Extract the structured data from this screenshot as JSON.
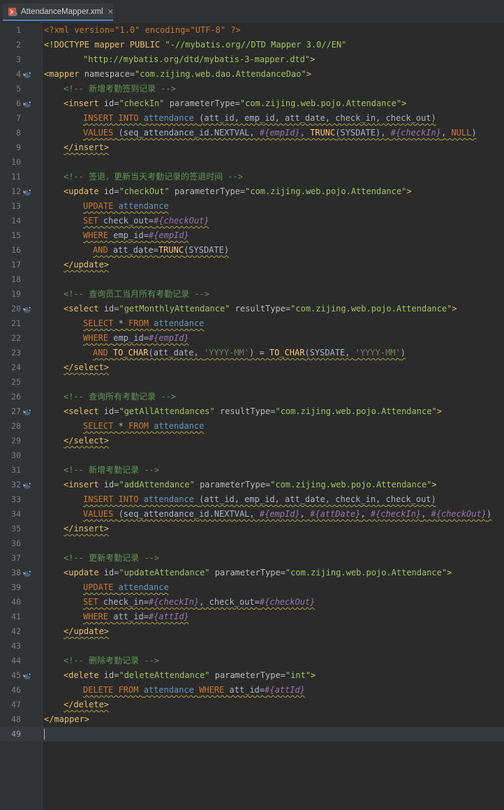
{
  "tab": {
    "title": "AttendanceMapper.xml",
    "close": "×",
    "icon": "xml-file-icon"
  },
  "current_line": 49,
  "lines": [
    {
      "n": "1",
      "bean": false,
      "parts": [
        [
          "xm",
          "<?xml version=\"1.0\" encoding=\"UTF-8\" ?>"
        ]
      ]
    },
    {
      "n": "2",
      "bean": false,
      "parts": [
        [
          "dt",
          "<!DOCTYPE mapper PUBLIC "
        ],
        [
          "av",
          "\"-//mybatis.org//DTD Mapper 3.0//EN\""
        ]
      ]
    },
    {
      "n": "3",
      "bean": false,
      "indent": "ind4",
      "parts": [
        [
          "av",
          "\"http://mybatis.org/dtd/mybatis-3-mapper.dtd\""
        ],
        [
          "dt",
          ">"
        ]
      ]
    },
    {
      "n": "4",
      "bean": true,
      "parts": [
        [
          "xt",
          "<mapper "
        ],
        [
          "an",
          "namespace="
        ],
        [
          "av",
          "\"com.zijing.web.dao.AttendanceDao\""
        ],
        [
          "xt",
          ">"
        ]
      ]
    },
    {
      "n": "5",
      "bean": false,
      "indent": "ind2",
      "parts": [
        [
          "cm",
          "<!-- 新增考勤签到记录 -->"
        ]
      ]
    },
    {
      "n": "6",
      "bean": true,
      "indent": "ind2",
      "parts": [
        [
          "xt",
          "<insert "
        ],
        [
          "an",
          "id="
        ],
        [
          "av",
          "\"checkIn\" "
        ],
        [
          "an",
          "parameterType="
        ],
        [
          "av",
          "\"com.zijing.web.pojo.Attendance\""
        ],
        [
          "xt",
          ">"
        ]
      ]
    },
    {
      "n": "7",
      "bean": false,
      "indent": "ind4",
      "sq": true,
      "parts": [
        [
          "kw",
          "INSERT INTO "
        ],
        [
          "tb",
          "attendance "
        ],
        [
          "pl",
          "(att_id, emp_id, att_date, check_in, check_out)"
        ]
      ]
    },
    {
      "n": "8",
      "bean": false,
      "indent": "ind4",
      "sq": true,
      "parts": [
        [
          "kw",
          "VALUES "
        ],
        [
          "pl",
          "(seq_attendance_id.NEXTVAL, "
        ],
        [
          "pm",
          "#{empId}"
        ],
        [
          "pl",
          ", "
        ],
        [
          "fn",
          "TRUNC"
        ],
        [
          "pl",
          "(SYSDATE), "
        ],
        [
          "pm",
          "#{checkIn}"
        ],
        [
          "pl",
          ", "
        ],
        [
          "kw",
          "NULL"
        ],
        [
          "pl",
          ")"
        ]
      ]
    },
    {
      "n": "9",
      "bean": false,
      "indent": "ind2",
      "sq": true,
      "parts": [
        [
          "xt",
          "</insert>"
        ]
      ]
    },
    {
      "n": "10",
      "bean": false,
      "parts": []
    },
    {
      "n": "11",
      "bean": false,
      "indent": "ind2",
      "parts": [
        [
          "cm",
          "<!-- 签退，更新当天考勤记录的签退时间 -->"
        ]
      ]
    },
    {
      "n": "12",
      "bean": true,
      "indent": "ind2",
      "parts": [
        [
          "xt",
          "<update "
        ],
        [
          "an",
          "id="
        ],
        [
          "av",
          "\"checkOut\" "
        ],
        [
          "an",
          "parameterType="
        ],
        [
          "av",
          "\"com.zijing.web.pojo.Attendance\""
        ],
        [
          "xt",
          ">"
        ]
      ]
    },
    {
      "n": "13",
      "bean": false,
      "indent": "ind4",
      "sq": true,
      "parts": [
        [
          "kw",
          "UPDATE "
        ],
        [
          "tb",
          "attendance"
        ]
      ]
    },
    {
      "n": "14",
      "bean": false,
      "indent": "ind4",
      "sq": true,
      "parts": [
        [
          "kw",
          "SET "
        ],
        [
          "pl",
          "check_out="
        ],
        [
          "pm",
          "#{checkOut}"
        ]
      ]
    },
    {
      "n": "15",
      "bean": false,
      "indent": "ind4",
      "sq": true,
      "parts": [
        [
          "kw",
          "WHERE "
        ],
        [
          "pl",
          "emp_id="
        ],
        [
          "pm",
          "#{empId}"
        ]
      ]
    },
    {
      "n": "16",
      "bean": false,
      "indent": "ind6",
      "sq": true,
      "parts": [
        [
          "kw",
          "AND "
        ],
        [
          "pl",
          "att_date="
        ],
        [
          "fn",
          "TRUNC"
        ],
        [
          "pl",
          "(SYSDATE)"
        ]
      ]
    },
    {
      "n": "17",
      "bean": false,
      "indent": "ind2",
      "sq": true,
      "parts": [
        [
          "xt",
          "</update>"
        ]
      ]
    },
    {
      "n": "18",
      "bean": false,
      "parts": []
    },
    {
      "n": "19",
      "bean": false,
      "indent": "ind2",
      "parts": [
        [
          "cm",
          "<!-- 查询员工当月所有考勤记录 -->"
        ]
      ]
    },
    {
      "n": "20",
      "bean": true,
      "indent": "ind2",
      "parts": [
        [
          "xt",
          "<select "
        ],
        [
          "an",
          "id="
        ],
        [
          "av",
          "\"getMonthlyAttendance\" "
        ],
        [
          "an",
          "resultType="
        ],
        [
          "av",
          "\"com.zijing.web.pojo.Attendance\""
        ],
        [
          "xt",
          ">"
        ]
      ]
    },
    {
      "n": "21",
      "bean": false,
      "indent": "ind4",
      "sq": true,
      "parts": [
        [
          "kw",
          "SELECT "
        ],
        [
          "pl",
          "* "
        ],
        [
          "kw",
          "FROM "
        ],
        [
          "tb",
          "attendance"
        ]
      ]
    },
    {
      "n": "22",
      "bean": false,
      "indent": "ind4",
      "sq": true,
      "parts": [
        [
          "kw",
          "WHERE "
        ],
        [
          "pl",
          "emp_id="
        ],
        [
          "pm",
          "#{empId}"
        ]
      ]
    },
    {
      "n": "23",
      "bean": false,
      "indent": "ind6",
      "sq": true,
      "parts": [
        [
          "kw",
          "AND "
        ],
        [
          "fn",
          "TO_CHAR"
        ],
        [
          "pl",
          "(att_date, "
        ],
        [
          "st",
          "'YYYY-MM'"
        ],
        [
          "pl",
          ") = "
        ],
        [
          "fn",
          "TO_CHAR"
        ],
        [
          "pl",
          "(SYSDATE, "
        ],
        [
          "st",
          "'YYYY-MM'"
        ],
        [
          "pl",
          ")"
        ]
      ]
    },
    {
      "n": "24",
      "bean": false,
      "indent": "ind2",
      "sq": true,
      "parts": [
        [
          "xt",
          "</select>"
        ]
      ]
    },
    {
      "n": "25",
      "bean": false,
      "parts": []
    },
    {
      "n": "26",
      "bean": false,
      "indent": "ind2",
      "parts": [
        [
          "cm",
          "<!-- 查询所有考勤记录 -->"
        ]
      ]
    },
    {
      "n": "27",
      "bean": true,
      "indent": "ind2",
      "parts": [
        [
          "xt",
          "<select "
        ],
        [
          "an",
          "id="
        ],
        [
          "av",
          "\"getAllAttendances\" "
        ],
        [
          "an",
          "resultType="
        ],
        [
          "av",
          "\"com.zijing.web.pojo.Attendance\""
        ],
        [
          "xt",
          ">"
        ]
      ]
    },
    {
      "n": "28",
      "bean": false,
      "indent": "ind4",
      "sq": true,
      "parts": [
        [
          "kw",
          "SELECT "
        ],
        [
          "pl",
          "* "
        ],
        [
          "kw",
          "FROM "
        ],
        [
          "tb",
          "attendance"
        ]
      ]
    },
    {
      "n": "29",
      "bean": false,
      "indent": "ind2",
      "sq": true,
      "parts": [
        [
          "xt",
          "</select>"
        ]
      ]
    },
    {
      "n": "30",
      "bean": false,
      "parts": []
    },
    {
      "n": "31",
      "bean": false,
      "indent": "ind2",
      "parts": [
        [
          "cm",
          "<!-- 新增考勤记录 -->"
        ]
      ]
    },
    {
      "n": "32",
      "bean": true,
      "indent": "ind2",
      "parts": [
        [
          "xt",
          "<insert "
        ],
        [
          "an",
          "id="
        ],
        [
          "av",
          "\"addAttendance\" "
        ],
        [
          "an",
          "parameterType="
        ],
        [
          "av",
          "\"com.zijing.web.pojo.Attendance\""
        ],
        [
          "xt",
          ">"
        ]
      ]
    },
    {
      "n": "33",
      "bean": false,
      "indent": "ind4",
      "sq": true,
      "parts": [
        [
          "kw",
          "INSERT INTO "
        ],
        [
          "tb",
          "attendance "
        ],
        [
          "pl",
          "(att_id, emp_id, att_date, check_in, check_out)"
        ]
      ]
    },
    {
      "n": "34",
      "bean": false,
      "indent": "ind4",
      "sq": true,
      "parts": [
        [
          "kw",
          "VALUES "
        ],
        [
          "pl",
          "(seq_attendance_id.NEXTVAL, "
        ],
        [
          "pm",
          "#{empId}"
        ],
        [
          "pl",
          ", "
        ],
        [
          "pm",
          "#{attDate}"
        ],
        [
          "pl",
          ", "
        ],
        [
          "pm",
          "#{checkIn}"
        ],
        [
          "pl",
          ", "
        ],
        [
          "pm",
          "#{checkOut}"
        ],
        [
          "pl",
          ")"
        ]
      ]
    },
    {
      "n": "35",
      "bean": false,
      "indent": "ind2",
      "sq": true,
      "parts": [
        [
          "xt",
          "</insert>"
        ]
      ]
    },
    {
      "n": "36",
      "bean": false,
      "parts": []
    },
    {
      "n": "37",
      "bean": false,
      "indent": "ind2",
      "parts": [
        [
          "cm",
          "<!-- 更新考勤记录 -->"
        ]
      ]
    },
    {
      "n": "38",
      "bean": true,
      "indent": "ind2",
      "parts": [
        [
          "xt",
          "<update "
        ],
        [
          "an",
          "id="
        ],
        [
          "av",
          "\"updateAttendance\" "
        ],
        [
          "an",
          "parameterType="
        ],
        [
          "av",
          "\"com.zijing.web.pojo.Attendance\""
        ],
        [
          "xt",
          ">"
        ]
      ]
    },
    {
      "n": "39",
      "bean": false,
      "indent": "ind4",
      "sq": true,
      "parts": [
        [
          "kw",
          "UPDATE "
        ],
        [
          "tb",
          "attendance"
        ]
      ]
    },
    {
      "n": "40",
      "bean": false,
      "indent": "ind4",
      "sq": true,
      "parts": [
        [
          "kw",
          "SET "
        ],
        [
          "pl",
          "check_in="
        ],
        [
          "pm",
          "#{checkIn}"
        ],
        [
          "pl",
          ", check_out="
        ],
        [
          "pm",
          "#{checkOut}"
        ]
      ]
    },
    {
      "n": "41",
      "bean": false,
      "indent": "ind4",
      "sq": true,
      "parts": [
        [
          "kw",
          "WHERE "
        ],
        [
          "pl",
          "att_id="
        ],
        [
          "pm",
          "#{attId}"
        ]
      ]
    },
    {
      "n": "42",
      "bean": false,
      "indent": "ind2",
      "sq": true,
      "parts": [
        [
          "xt",
          "</update>"
        ]
      ]
    },
    {
      "n": "43",
      "bean": false,
      "parts": []
    },
    {
      "n": "44",
      "bean": false,
      "indent": "ind2",
      "parts": [
        [
          "cm",
          "<!-- 删除考勤记录 -->"
        ]
      ]
    },
    {
      "n": "45",
      "bean": true,
      "indent": "ind2",
      "parts": [
        [
          "xt",
          "<delete "
        ],
        [
          "an",
          "id="
        ],
        [
          "av",
          "\"deleteAttendance\" "
        ],
        [
          "an",
          "parameterType="
        ],
        [
          "av",
          "\"int\""
        ],
        [
          "xt",
          ">"
        ]
      ]
    },
    {
      "n": "46",
      "bean": false,
      "indent": "ind4",
      "sq": true,
      "parts": [
        [
          "kw",
          "DELETE FROM "
        ],
        [
          "tb",
          "attendance "
        ],
        [
          "kw",
          "WHERE "
        ],
        [
          "pl",
          "att_id="
        ],
        [
          "pm",
          "#{attId}"
        ]
      ]
    },
    {
      "n": "47",
      "bean": false,
      "indent": "ind2",
      "sq": true,
      "parts": [
        [
          "xt",
          "</delete>"
        ]
      ]
    },
    {
      "n": "48",
      "bean": false,
      "parts": [
        [
          "xt",
          "</mapper>"
        ]
      ]
    },
    {
      "n": "49",
      "bean": false,
      "parts": []
    }
  ]
}
